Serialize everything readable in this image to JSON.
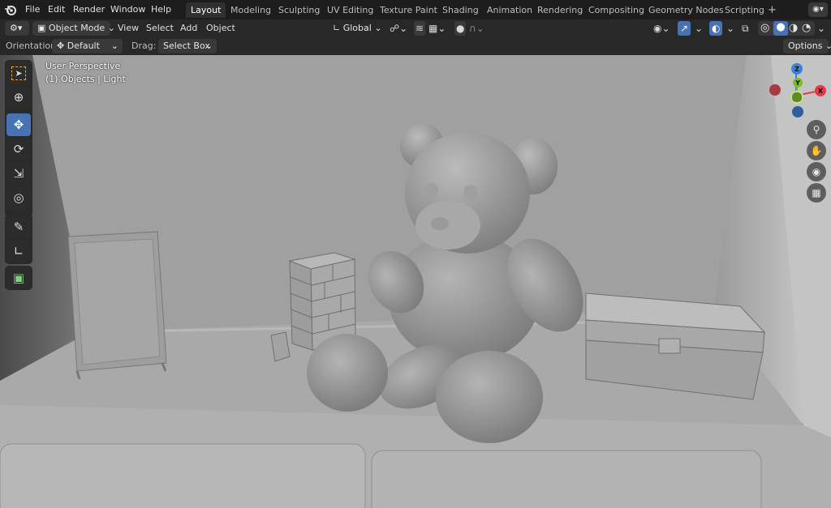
{
  "app": {
    "logo_icon": "blender-logo-icon"
  },
  "menu": [
    "File",
    "Edit",
    "Render",
    "Window",
    "Help"
  ],
  "workspaces": [
    "Layout",
    "Modeling",
    "Sculpting",
    "UV Editing",
    "Texture Paint",
    "Shading",
    "Animation",
    "Rendering",
    "Compositing",
    "Geometry Nodes",
    "Scripting"
  ],
  "active_workspace": "Layout",
  "add_workspace": "+",
  "header": {
    "mode": "Object Mode",
    "menus": [
      "View",
      "Select",
      "Add",
      "Object"
    ],
    "transform_orientation": "Global"
  },
  "tool_settings": {
    "orientation_label": "Orientation:",
    "orientation_value": "Default",
    "drag_label": "Drag:",
    "drag_value": "Select Box",
    "options": "Options"
  },
  "viewport": {
    "view_name": "User Perspective",
    "selection_info": "(1) Objects | Light"
  },
  "gizmo": {
    "z": "Z",
    "y": "Y",
    "x": "X"
  },
  "colors": {
    "accent": "#4772b3",
    "x_axis": "#e33a4a",
    "y_axis": "#7fba2d",
    "z_axis": "#3b82d6"
  },
  "toolbar_icons": [
    "select-box-icon",
    "cursor-icon",
    "move-icon",
    "rotate-icon",
    "scale-icon",
    "transform-icon",
    "annotate-icon",
    "measure-icon",
    "add-cube-icon"
  ],
  "nav_icons": [
    "zoom-icon",
    "pan-hand-icon",
    "camera-icon",
    "perspective-grid-icon"
  ]
}
